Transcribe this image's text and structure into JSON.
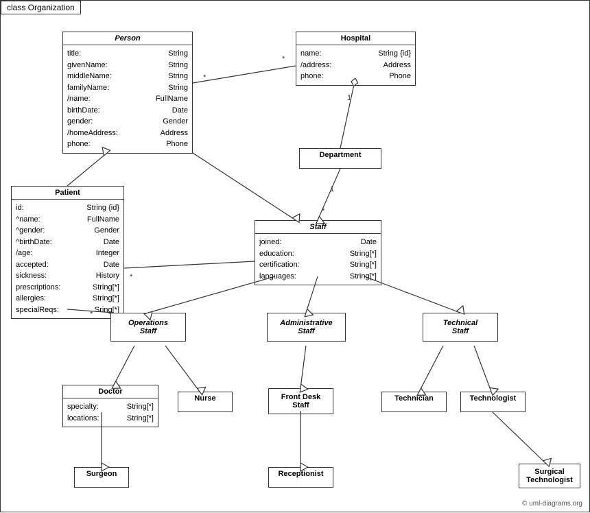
{
  "title": "class Organization",
  "classes": {
    "Person": {
      "name": "Person",
      "italic": true,
      "attrs": [
        {
          "name": "title:",
          "type": "String"
        },
        {
          "name": "givenName:",
          "type": "String"
        },
        {
          "name": "middleName:",
          "type": "String"
        },
        {
          "name": "familyName:",
          "type": "String"
        },
        {
          "name": "/name:",
          "type": "FullName"
        },
        {
          "name": "birthDate:",
          "type": "Date"
        },
        {
          "name": "gender:",
          "type": "Gender"
        },
        {
          "name": "/homeAddress:",
          "type": "Address"
        },
        {
          "name": "phone:",
          "type": "Phone"
        }
      ]
    },
    "Hospital": {
      "name": "Hospital",
      "italic": false,
      "attrs": [
        {
          "name": "name:",
          "type": "String {id}"
        },
        {
          "name": "/address:",
          "type": "Address"
        },
        {
          "name": "phone:",
          "type": "Phone"
        }
      ]
    },
    "Department": {
      "name": "Department",
      "italic": false,
      "attrs": []
    },
    "Staff": {
      "name": "Staff",
      "italic": true,
      "attrs": [
        {
          "name": "joined:",
          "type": "Date"
        },
        {
          "name": "education:",
          "type": "String[*]"
        },
        {
          "name": "certification:",
          "type": "String[*]"
        },
        {
          "name": "languages:",
          "type": "String[*]"
        }
      ]
    },
    "Patient": {
      "name": "Patient",
      "italic": false,
      "attrs": [
        {
          "name": "id:",
          "type": "String {id}"
        },
        {
          "name": "^name:",
          "type": "FullName"
        },
        {
          "name": "^gender:",
          "type": "Gender"
        },
        {
          "name": "^birthDate:",
          "type": "Date"
        },
        {
          "name": "/age:",
          "type": "Integer"
        },
        {
          "name": "accepted:",
          "type": "Date"
        },
        {
          "name": "sickness:",
          "type": "History"
        },
        {
          "name": "prescriptions:",
          "type": "String[*]"
        },
        {
          "name": "allergies:",
          "type": "String[*]"
        },
        {
          "name": "specialReqs:",
          "type": "Sring[*]"
        }
      ]
    },
    "OperationsStaff": {
      "name": "Operations\nStaff",
      "italic": true,
      "attrs": []
    },
    "AdministrativeStaff": {
      "name": "Administrative\nStaff",
      "italic": true,
      "attrs": []
    },
    "TechnicalStaff": {
      "name": "Technical\nStaff",
      "italic": true,
      "attrs": []
    },
    "Doctor": {
      "name": "Doctor",
      "italic": false,
      "attrs": [
        {
          "name": "specialty:",
          "type": "String[*]"
        },
        {
          "name": "locations:",
          "type": "String[*]"
        }
      ]
    },
    "Nurse": {
      "name": "Nurse",
      "italic": false,
      "attrs": []
    },
    "FrontDeskStaff": {
      "name": "Front Desk\nStaff",
      "italic": false,
      "attrs": []
    },
    "Technician": {
      "name": "Technician",
      "italic": false,
      "attrs": []
    },
    "Technologist": {
      "name": "Technologist",
      "italic": false,
      "attrs": []
    },
    "Surgeon": {
      "name": "Surgeon",
      "italic": false,
      "attrs": []
    },
    "Receptionist": {
      "name": "Receptionist",
      "italic": false,
      "attrs": []
    },
    "SurgicalTechnologist": {
      "name": "Surgical\nTechnologist",
      "italic": false,
      "attrs": []
    }
  },
  "copyright": "© uml-diagrams.org"
}
